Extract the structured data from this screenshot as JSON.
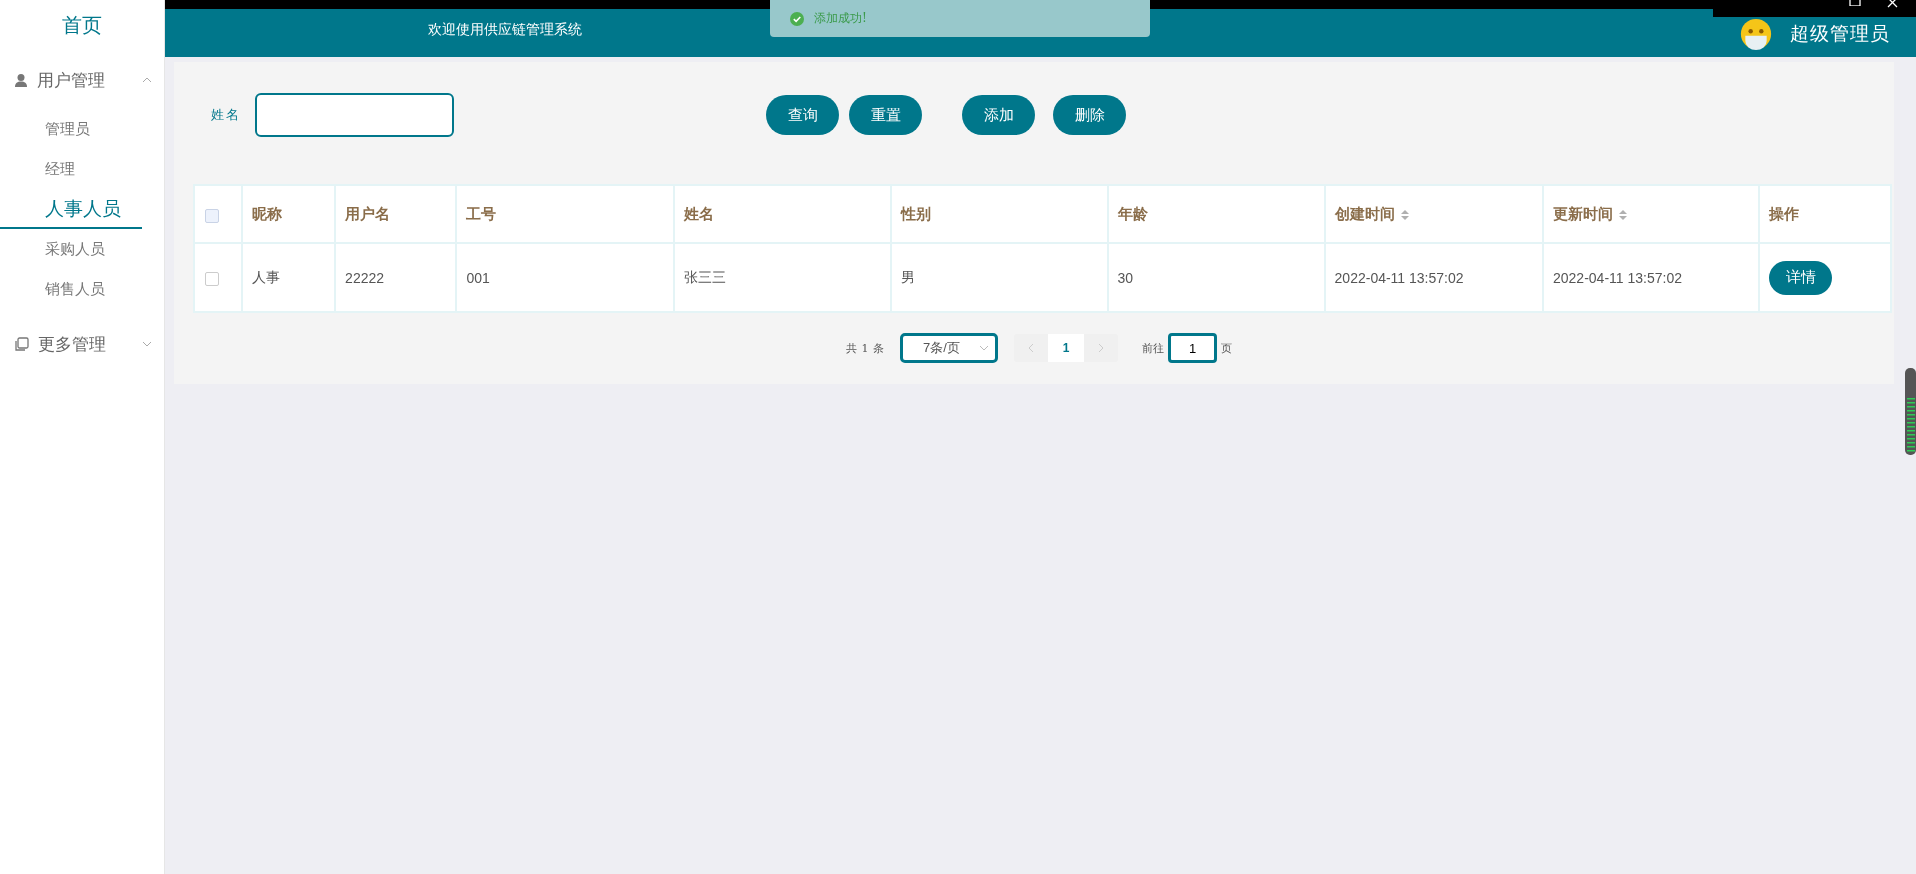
{
  "sidebar": {
    "home": "首页",
    "groups": [
      {
        "label": "用户管理",
        "expanded": true,
        "items": [
          {
            "label": "管理员",
            "selected": false
          },
          {
            "label": "经理",
            "selected": false
          },
          {
            "label": "人事人员",
            "selected": true
          },
          {
            "label": "采购人员",
            "selected": false
          },
          {
            "label": "销售人员",
            "selected": false
          }
        ]
      },
      {
        "label": "更多管理",
        "expanded": false
      }
    ]
  },
  "header": {
    "welcome": "欢迎使用供应链管理系统",
    "user": "超级管理员"
  },
  "toast": {
    "kind": "success",
    "message": "添加成功!"
  },
  "search": {
    "label": "姓名",
    "buttons": [
      "查询",
      "重置",
      "添加",
      "删除"
    ]
  },
  "table": {
    "all_checked": false,
    "columns": [
      {
        "label": "昵称",
        "sortable": false
      },
      {
        "label": "用户名",
        "sortable": false
      },
      {
        "label": "工号",
        "sortable": false
      },
      {
        "label": "姓名",
        "sortable": false
      },
      {
        "label": "性别",
        "sortable": false
      },
      {
        "label": "年龄",
        "sortable": false
      },
      {
        "label": "创建时间",
        "sortable": true
      },
      {
        "label": "更新时间",
        "sortable": true
      },
      {
        "label": "操作",
        "sortable": false
      }
    ],
    "rows": [
      {
        "checked": false,
        "cells": [
          "人事",
          "22222",
          "001",
          "张三三",
          "男",
          "30",
          "2022-04-11 13:57:02",
          "2022-04-11 13:57:02"
        ],
        "action": "详情"
      }
    ]
  },
  "pagination": {
    "total": "共 1 条",
    "page_size": "7条/页",
    "pages": [
      {
        "label": "1",
        "selected": true
      }
    ],
    "goto_label": "前往",
    "goto_value": "1",
    "page_suffix": "页"
  }
}
